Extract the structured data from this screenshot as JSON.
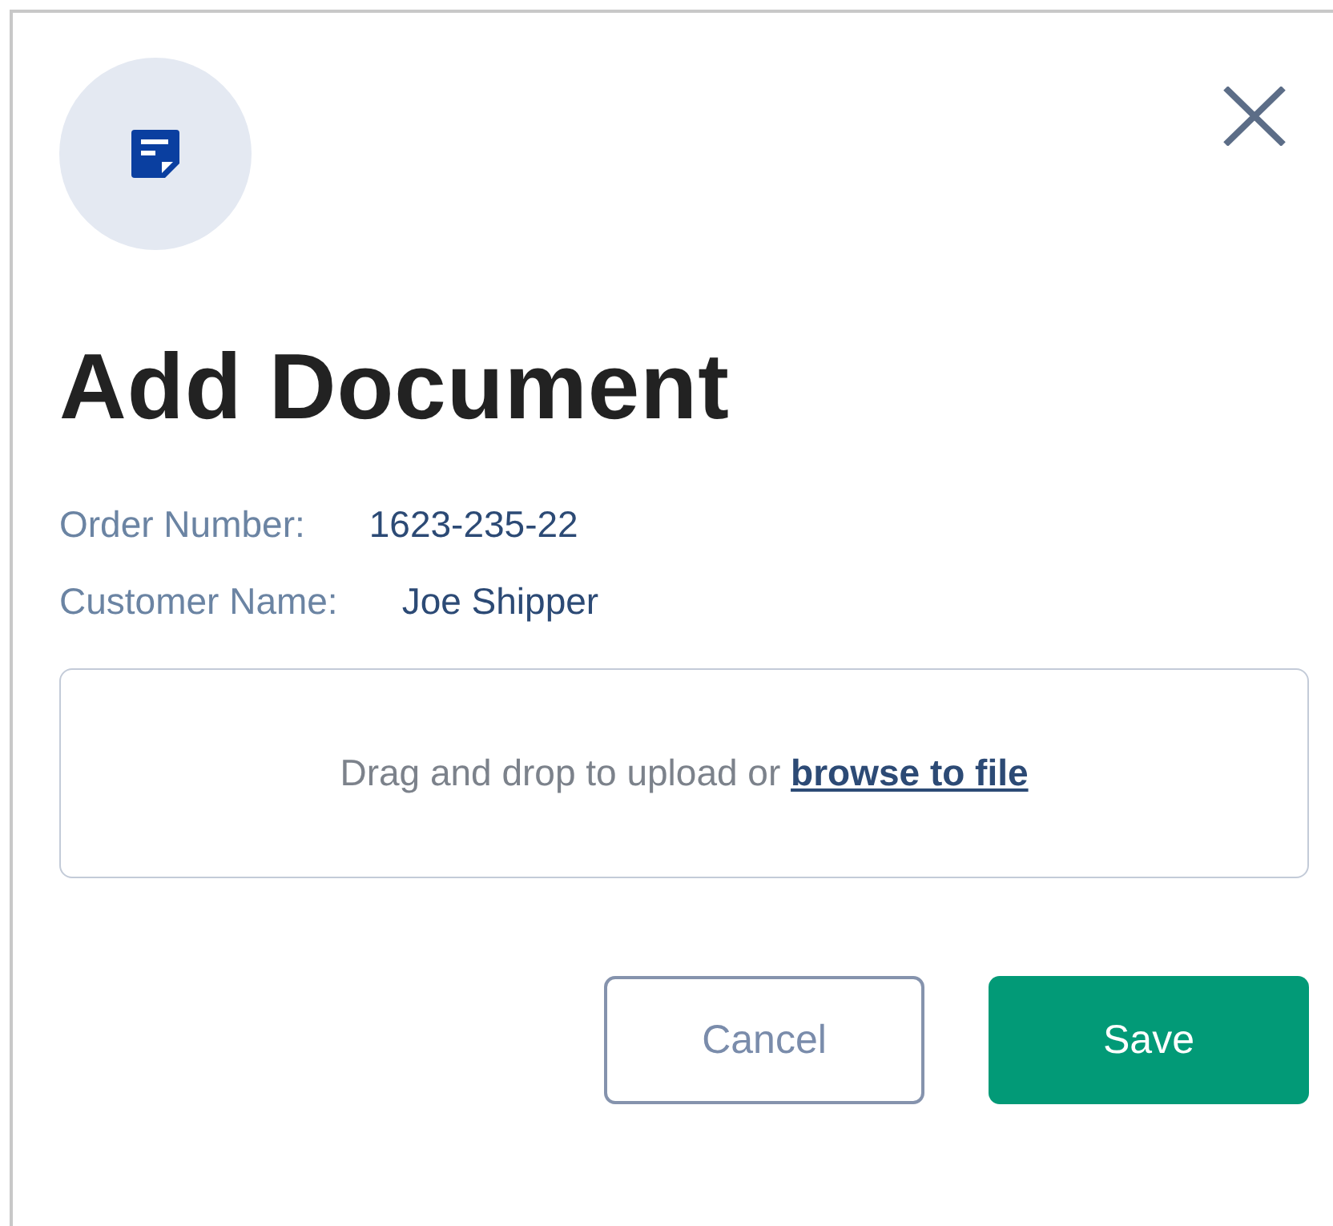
{
  "dialog": {
    "title": "Add Document",
    "fields": [
      {
        "label": "Order Number:",
        "value": "1623-235-22"
      },
      {
        "label": "Customer Name:",
        "value": "Joe Shipper"
      }
    ],
    "upload": {
      "text": "Drag and drop to upload or ",
      "link": "browse to file"
    },
    "buttons": [
      {
        "label": "Cancel",
        "kind": "secondary"
      },
      {
        "label": "Save",
        "kind": "primary"
      }
    ]
  }
}
